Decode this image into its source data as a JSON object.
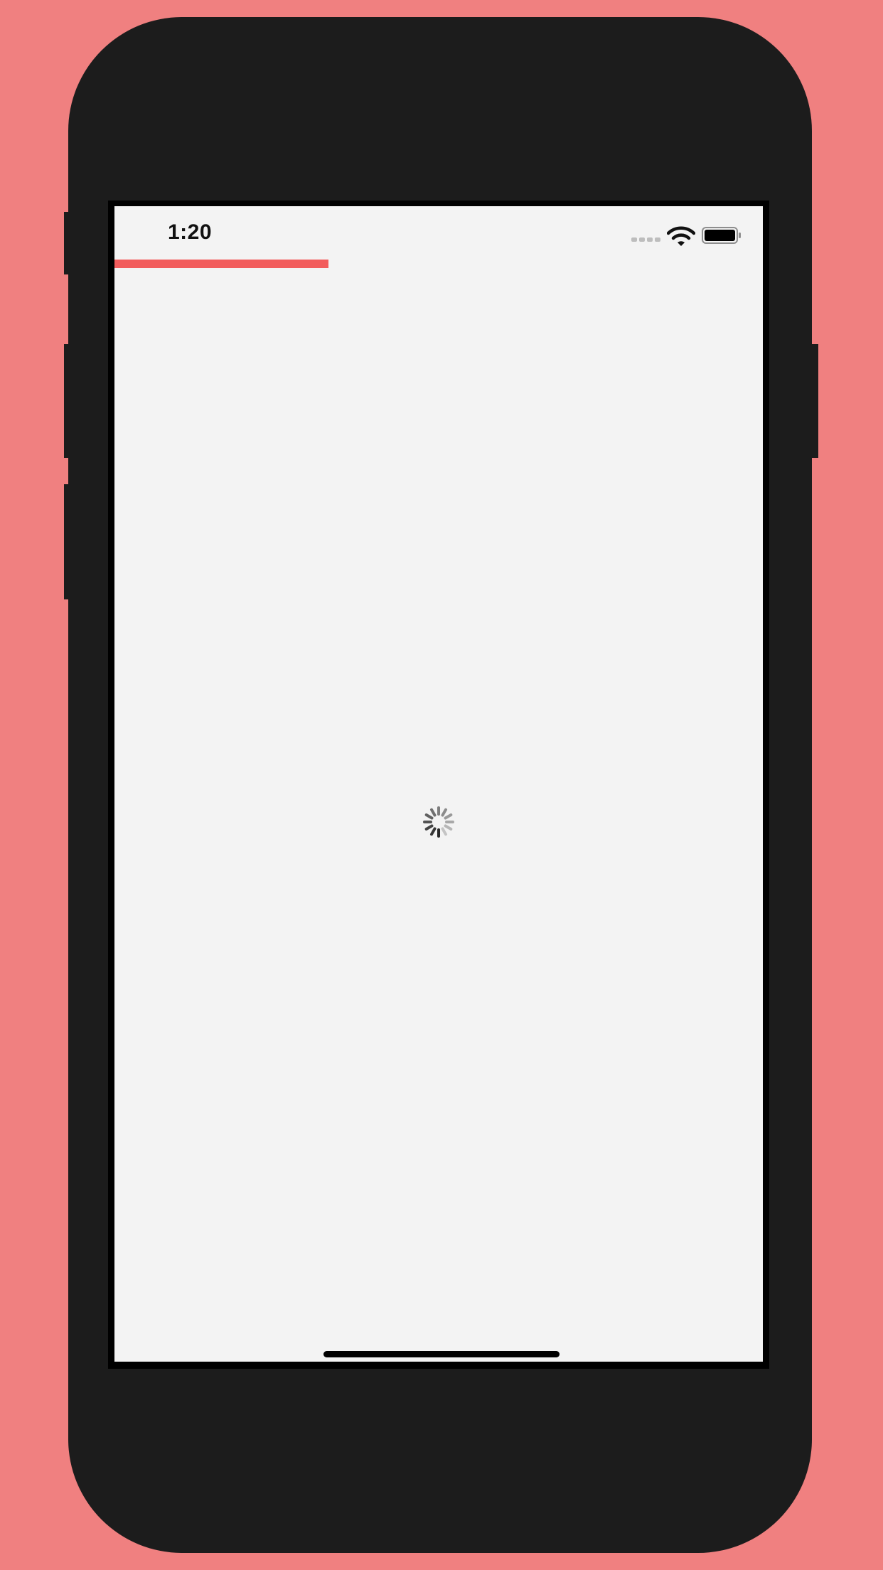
{
  "status_bar": {
    "time": "1:20",
    "signal_icon": "cellular-signal-icon",
    "wifi_icon": "wifi-icon",
    "battery_icon": "battery-icon"
  },
  "loading_progress": {
    "fraction": 0.33,
    "color": "#f25c5c"
  },
  "content": {
    "state": "loading",
    "indicator_icon": "activity-spinner-icon"
  },
  "colors": {
    "page_background": "#f08080",
    "device_frame": "#1c1c1c",
    "screen_background": "#f3f3f3",
    "accent": "#f25c5c"
  }
}
